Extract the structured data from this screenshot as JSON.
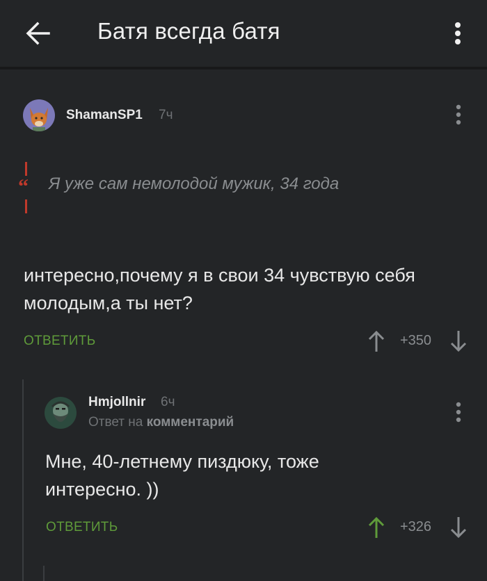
{
  "header": {
    "title": "Батя всегда батя",
    "back_icon": "arrow-left-icon",
    "menu_icon": "more-vert-icon"
  },
  "comments": [
    {
      "username": "ShamanSP1",
      "time": "7ч",
      "avatar_icon": "fox-avatar",
      "quote": "Я уже сам немолодой мужик, 34 года",
      "text_lines": [
        "интересно,почему я в свои 34 чувствую себя",
        "молодым,а ты нет?"
      ],
      "reply_label": "ОТВЕТИТЬ",
      "score": "+350",
      "vote_state": "none"
    },
    {
      "username": "Hmjollnir",
      "time": "6ч",
      "avatar_icon": "bearded-man-avatar",
      "reply_to_prefix": "Ответ на",
      "reply_to_target": "комментарий",
      "text_lines": [
        "Мне, 40-летнему пиздюку, тоже",
        "интересно. ))"
      ],
      "reply_label": "ОТВЕТИТЬ",
      "score": "+326",
      "vote_state": "up"
    }
  ],
  "colors": {
    "background": "#232527",
    "accent_green": "#5f9b3a",
    "muted_text": "#8a8d90"
  }
}
